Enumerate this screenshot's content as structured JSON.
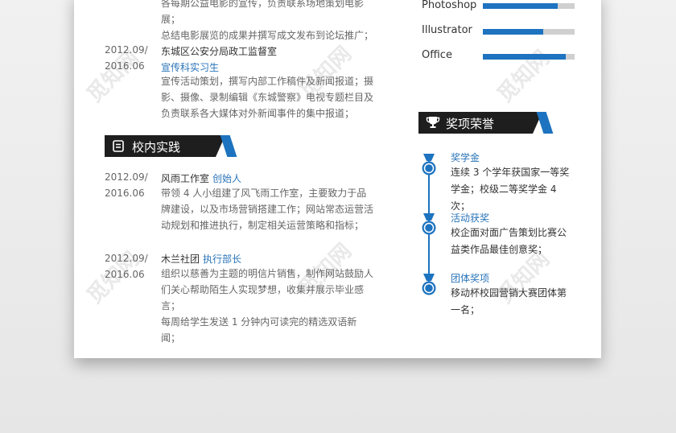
{
  "experience": {
    "intro_lines": [
      "各每期公益电影的宣传，负责联系场地策划电影展；",
      "总结电影展览的成果并撰写成文发布到论坛推广；"
    ],
    "item": {
      "period_start": "2012.09/",
      "period_end": "2016.06",
      "org": "东城区公安分局政工监督室",
      "role": "宣传科实习生",
      "desc_lines": [
        "宣传活动策划，撰写内部工作稿件及新闻报道；摄",
        "影、摄像、录制编辑《东城警察》电视专题栏目及",
        "负责联系各大媒体对外新闻事件的集中报道；"
      ]
    }
  },
  "campus": {
    "title": "校内实践",
    "items": [
      {
        "period_start": "2012.09/",
        "period_end": "2016.06",
        "org": "风雨工作室",
        "role": "创始人",
        "desc_lines": [
          "带领 4 人小组建了风飞雨工作室，主要致力于品",
          "牌建设，以及市场营销搭建工作；网站常态运营活",
          "动规划和推进执行，制定相关运营策略和指标；"
        ]
      },
      {
        "period_start": "2012.09/",
        "period_end": "2016.06",
        "org": "木兰社团",
        "role": "执行部长",
        "desc_lines": [
          "组织以慈善为主题的明信片销售，制作网站鼓励人",
          "们关心帮助陌生人实现梦想，收集并展示毕业感言；",
          "每周给学生发送 1 分钟内可读完的精选双语新闻；"
        ]
      }
    ]
  },
  "skills": [
    {
      "name": "Photoshop",
      "level": 0.82
    },
    {
      "name": "Illustrator",
      "level": 0.66
    },
    {
      "name": "Office",
      "level": 0.9
    }
  ],
  "awards": {
    "title": "奖项荣誉",
    "items": [
      {
        "title": "奖学金",
        "desc": "连续 3 个学年获国家一等奖学金；校级二等奖学金 4 次；"
      },
      {
        "title": "活动获奖",
        "desc": "校企面对面广告策划比赛公益类作品最佳创意奖；"
      },
      {
        "title": "团体奖项",
        "desc": "移动杯校园营销大赛团体第一名；"
      }
    ]
  },
  "watermark": "觅知网",
  "colors": {
    "accent": "#1d73bf",
    "dark_bar": "#1e1e1e",
    "background": "#ececec"
  },
  "icons": {
    "campus": "document-icon",
    "awards": "trophy-icon",
    "award_item": "medal-icon"
  }
}
